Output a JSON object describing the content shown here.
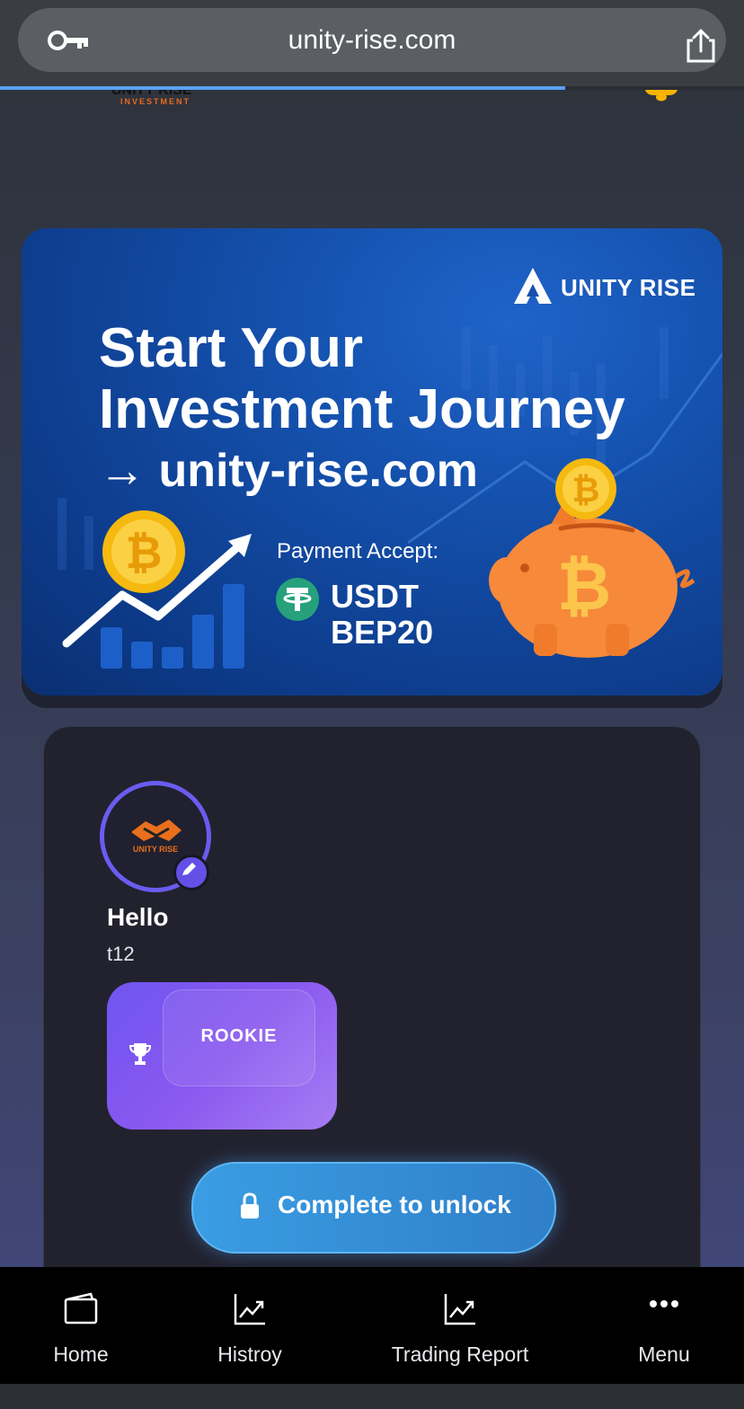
{
  "browser": {
    "url": "unity-rise.com",
    "load_progress": 0.76,
    "icons": [
      "key-icon",
      "share-icon"
    ]
  },
  "header": {
    "logo_top": "UNITY RISE",
    "logo_sub": "INVESTMENT"
  },
  "banner": {
    "brand": "UNITY RISE",
    "headline_1": "Start Your",
    "headline_2": "Investment Journey",
    "headline_3": "→ unity-rise.com",
    "payment_label": "Payment Accept:",
    "payment_coin": "USDT",
    "payment_network": "BEP20"
  },
  "profile": {
    "greeting": "Hello",
    "username": "t12",
    "avatar_text": "UNITY RISE",
    "rank": "ROOKIE",
    "unlock_button": "Complete to unlock"
  },
  "nav": {
    "items": [
      {
        "label": "Home",
        "icon": "wallet-icon"
      },
      {
        "label": "Histroy",
        "icon": "chart-icon"
      },
      {
        "label": "Trading Report",
        "icon": "chart-icon"
      },
      {
        "label": "Menu",
        "icon": "more-icon"
      }
    ]
  },
  "colors": {
    "accent_purple": "#6a5cf0",
    "unlock_blue": "#3a9de3",
    "banner_blue": "#1450ac",
    "coin_gold": "#f5b90f",
    "brand_orange": "#f07a1a"
  }
}
